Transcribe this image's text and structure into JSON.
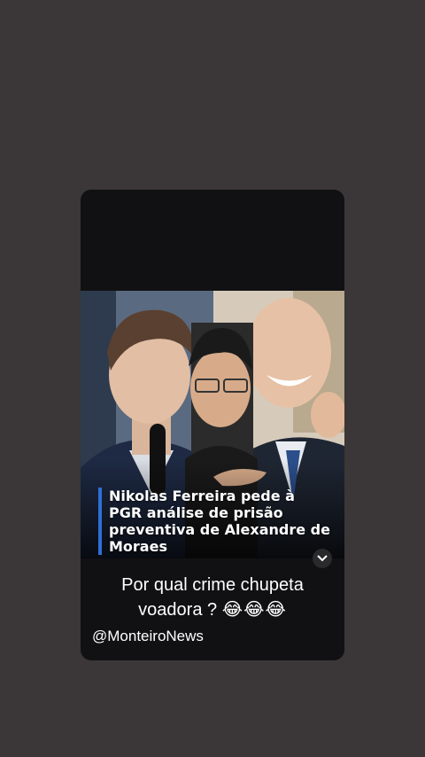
{
  "post": {
    "headline": "Nikolas Ferreira pede à PGR análise de prisão preventiva de Alexandre de Moraes",
    "caption_line1": "Por qual crime chupeta",
    "caption_line2": "voadora ?",
    "caption_emoji": "😂😂😂",
    "handle": "@MonteiroNews"
  },
  "colors": {
    "background": "#3b3637",
    "card": "#111113",
    "accent_bar": "#2f6fd6"
  },
  "icons": {
    "more": "chevron-down-icon"
  }
}
